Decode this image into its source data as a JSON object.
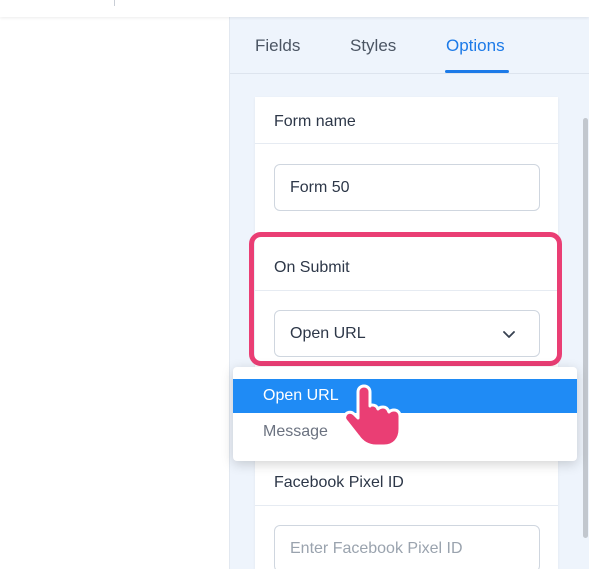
{
  "tabs": [
    {
      "label": "Fields"
    },
    {
      "label": "Styles"
    },
    {
      "label": "Options"
    }
  ],
  "active_tab": "Options",
  "form_name": {
    "label": "Form name",
    "value": "Form 50"
  },
  "on_submit": {
    "label": "On Submit",
    "selected": "Open URL",
    "options": [
      "Open URL",
      "Message"
    ]
  },
  "facebook_pixel": {
    "label": "Facebook Pixel ID",
    "placeholder": "Enter Facebook Pixel ID"
  },
  "colors": {
    "accent": "#1c7ae8",
    "highlight": "#ea3e74",
    "selected_option_bg": "#1f8bf5",
    "panel_bg": "#eef4fc"
  },
  "icons": {
    "select_arrow": "chevron-down-icon",
    "cursor": "hand-pointer-icon"
  }
}
